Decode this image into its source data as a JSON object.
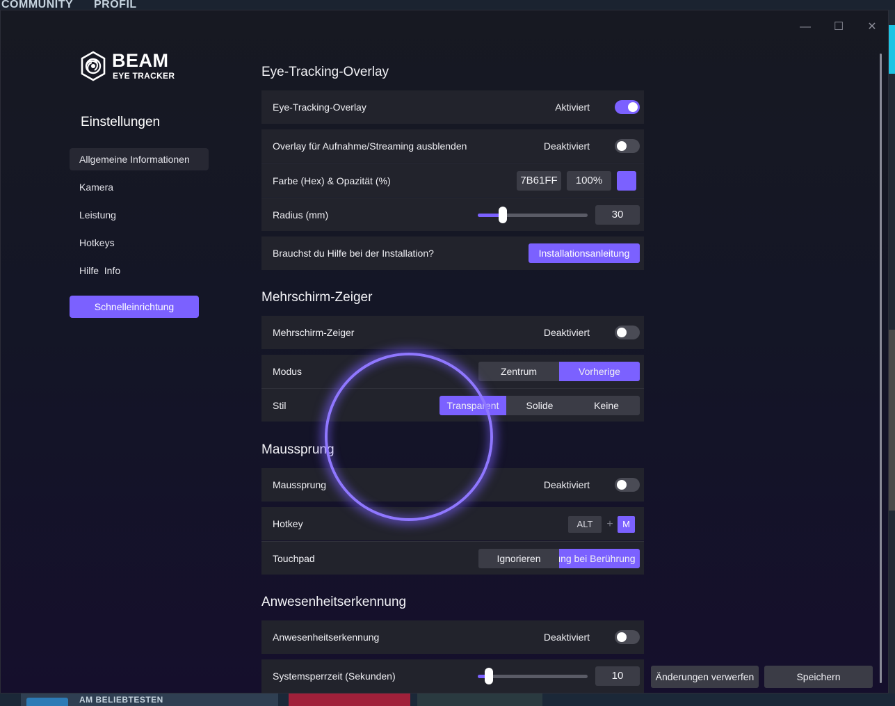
{
  "background_app": {
    "nav": [
      "COMMUNITY",
      "PROFIL"
    ],
    "bottom_label": "AM BELIEBTESTEN"
  },
  "window": {
    "controls": {
      "minimize": "—",
      "maximize": "☐",
      "close": "✕"
    }
  },
  "logo": {
    "title": "BEAM",
    "subtitle": "EYE TRACKER"
  },
  "sidebar": {
    "title": "Einstellungen",
    "items": [
      {
        "label": "Allgemeine Informationen",
        "active": true
      },
      {
        "label": "Kamera"
      },
      {
        "label": "Leistung"
      },
      {
        "label": "Hotkeys"
      },
      {
        "label": "Hilfe  Info"
      }
    ],
    "quick_setup": "Schnelleinrichtung"
  },
  "sections": {
    "overlay": {
      "title": "Eye-Tracking-Overlay",
      "toggle_label": "Eye-Tracking-Overlay",
      "toggle_status": "Aktiviert",
      "hide_label": "Overlay für Aufnahme/Streaming ausblenden",
      "hide_status": "Deaktiviert",
      "color_label": "Farbe (Hex) & Opazität (%)",
      "color_hex": "7B61FF",
      "opacity": "100%",
      "radius_label": "Radius (mm)",
      "radius_value": "30",
      "radius_fraction": 0.23,
      "help_label": "Brauchst du Hilfe bei der Installation?",
      "help_button": "Installationsanleitung"
    },
    "multiscreen": {
      "title": "Mehrschirm-Zeiger",
      "toggle_label": "Mehrschirm-Zeiger",
      "toggle_status": "Deaktiviert",
      "mode_label": "Modus",
      "mode_options": [
        "Zentrum",
        "Vorherige"
      ],
      "mode_selected": "Vorherige",
      "style_label": "Stil",
      "style_options": [
        "Transparent",
        "Solide",
        "Keine"
      ],
      "style_selected": "Transparent"
    },
    "mousejump": {
      "title": "Maussprung",
      "toggle_label": "Maussprung",
      "toggle_status": "Deaktiviert",
      "hotkey_label": "Hotkey",
      "hotkey_mod": "ALT",
      "hotkey_plus": "+",
      "hotkey_key": "M",
      "touchpad_label": "Touchpad",
      "touchpad_options": [
        "Ignorieren",
        "Sprung bei Berührung"
      ],
      "touchpad_selected": "Sprung bei Berührung"
    },
    "presence": {
      "title": "Anwesenheitserkennung",
      "toggle_label": "Anwesenheitserkennung",
      "toggle_status": "Deaktiviert",
      "lock_label": "Systemsperrzeit (Sekunden)",
      "lock_value": "10",
      "lock_fraction": 0.1
    }
  },
  "actions": {
    "discard": "Änderungen verwerfen",
    "save": "Speichern"
  },
  "colors": {
    "accent": "#7B61FF"
  }
}
